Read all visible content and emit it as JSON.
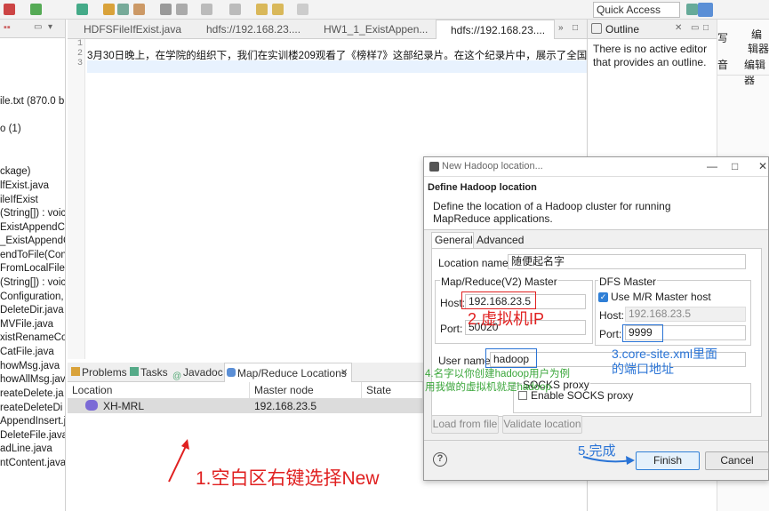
{
  "toolbar": {
    "quick_access": "Quick Access"
  },
  "left_view": {
    "lines": [
      "ile.txt (870.0 b",
      "o (1)",
      "ckage)",
      "lfExist.java",
      "ileIfExist",
      "(String[]) : voic",
      "ExistAppendCo",
      "_ExistAppendC",
      "endToFile(Conf",
      "FromLocalFile",
      "(String[]) : voic",
      "Configuration,",
      "DeleteDir.java",
      "MVFile.java",
      "xistRenameCo",
      "CatFile.java",
      "howMsg.java",
      "howAllMsg.jav",
      "reateDelete.ja",
      "reateDeleteDi",
      "AppendInsert.ja",
      "DeleteFile.java",
      "adLine.java",
      "ntContent.java"
    ]
  },
  "editor": {
    "tabs": [
      {
        "label": "HDFSFileIfExist.java"
      },
      {
        "label": "hdfs://192.168.23...."
      },
      {
        "label": "HW1_1_ExistAppen..."
      },
      {
        "label": "hdfs://192.168.23...."
      }
    ],
    "line_numbers": [
      "1",
      "2",
      "3"
    ],
    "content": "3月30日晚上，在学院的组织下，我们在实训楼209观看了《榜样7》这部纪录片。在这个纪录片中，展示了全国优秀共产"
  },
  "outline": {
    "title": "Outline",
    "message": "There is no active editor that provides an outline."
  },
  "right_edge": {
    "items": [
      "写",
      "音",
      "编",
      "辑器",
      "编辑器"
    ]
  },
  "bottom_panel": {
    "tabs": [
      "Problems",
      "Tasks",
      "Javadoc",
      "Map/Reduce Locations"
    ],
    "columns": [
      "Location",
      "Master node",
      "State"
    ],
    "rows": [
      {
        "location": "XH-MRL",
        "master": "192.168.23.5",
        "state": ""
      }
    ]
  },
  "dialog": {
    "title": "New Hadoop location...",
    "header_title": "Define Hadoop location",
    "header_desc": "Define the location of a Hadoop cluster for running MapReduce applications.",
    "tabs": [
      "General",
      "Advanced parameters"
    ],
    "location_name_label": "Location name:",
    "location_name_value": "随便起名字",
    "mr_master_label": "Map/Reduce(V2) Master",
    "host_label": "Host:",
    "host_value": "192.168.23.5",
    "port_label": "Port:",
    "port_value": "50020",
    "dfs_master_label": "DFS Master",
    "use_mr_label": "Use M/R Master host",
    "dfs_host_label": "Host:",
    "dfs_host_value": "192.168.23.5",
    "dfs_port_label": "Port:",
    "dfs_port_value": "9999",
    "username_label": "User name:",
    "username_value": "hadoop",
    "socks_group_label": "SOCKS proxy",
    "enable_socks_label": "Enable SOCKS proxy",
    "load_btn": "Load from file",
    "validate_btn": "Validate location",
    "finish_btn": "Finish",
    "cancel_btn": "Cancel"
  },
  "annotations": {
    "a1": "1.空白区右键选择New",
    "a2": "2.虚拟机IP",
    "a3_l1": "3.core-site.xml里面",
    "a3_l2": "的端口地址",
    "a4_l1": "4.名字以你创建hadoop用户为例",
    "a4_l2": "用我做的虚拟机就是hadoop",
    "a5": "5.完成"
  },
  "colors": {
    "annotation_red": "#e02020",
    "annotation_blue": "#2a74d6",
    "annotation_green": "#3aa63a",
    "accent": "#2f7fd6"
  }
}
